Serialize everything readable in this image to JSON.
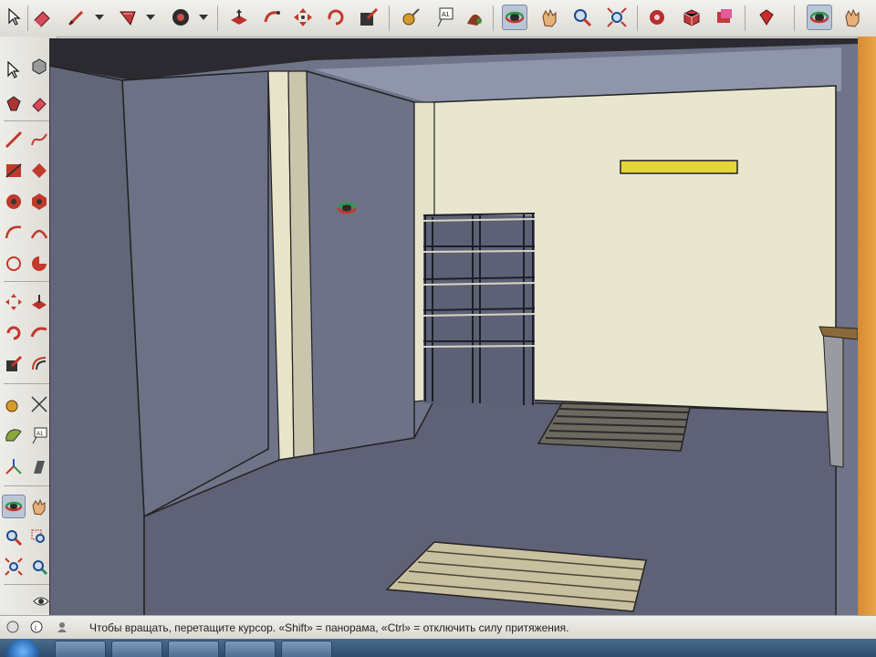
{
  "toolbar": {
    "top_icons": [
      "select-icon",
      "eraser-icon",
      "pencil-icon",
      "paint-bucket-icon",
      "circle-icon",
      "push-pull-icon",
      "follow-me-icon",
      "move-icon",
      "rotate-icon",
      "scale-icon",
      "tape-measure-icon",
      "text-icon",
      "paint-icon",
      "orbit-icon",
      "pan-icon",
      "zoom-icon",
      "zoom-extents-icon",
      "warehouse-icon",
      "components-icon",
      "extension-icon",
      "ruby-icon",
      "orbit-icon",
      "pan-icon"
    ],
    "text_tool_glyph": "A1"
  },
  "left_toolbar": {
    "text_tool_glyph": "A1"
  },
  "status": {
    "message": "Чтобы вращать, перетащите курсор. «Shift» = панорама, «Ctrl» = отключить силу притяжения."
  },
  "colors": {
    "accent": "#d88a30",
    "viewport_bg": "#6f7488",
    "wall_cream": "#e9e6cf",
    "floor": "#5f6276",
    "lamp_yellow": "#e5d53a"
  }
}
